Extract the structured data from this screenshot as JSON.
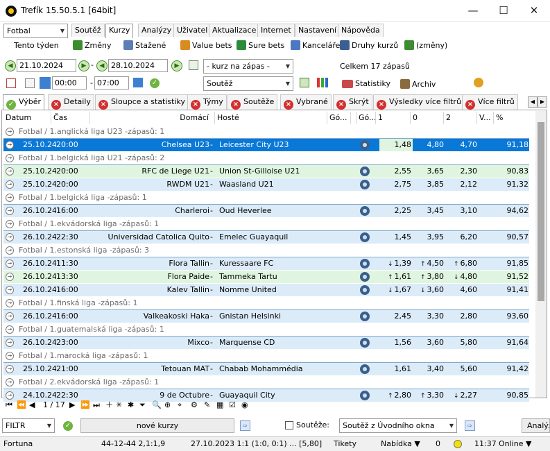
{
  "window": {
    "title": "Trefík 15.50.5.1 [64bit]",
    "min": "—",
    "max": "☐",
    "close": "✕"
  },
  "sport_select": "Fotbal",
  "top_tabs": [
    "Soutěž",
    "Kurzy",
    "Analýzy",
    "Uživatel",
    "Aktualizace",
    "Internet",
    "Nastavení",
    "Nápověda"
  ],
  "period_button": "Tento týden",
  "toolbar": {
    "zmeny": "Změny",
    "stazene": "Stažené",
    "value_bets": "Value bets",
    "sure_bets": "Sure bets",
    "kancelare": "Kanceláře",
    "druhy_kurzu": "Druhy kurzů",
    "zmeny2": "(změny)"
  },
  "filters": {
    "date_from": "21.10.2024",
    "date_to": "28.10.2024",
    "dash": "-",
    "time_from": "00:00",
    "time_to": "07:00",
    "odds_select": "- kurz na zápas -",
    "comp_select": "Soutěž",
    "total": "Celkem 17 zápasů",
    "statistiky": "Statistiky",
    "archiv": "Archiv"
  },
  "bottom_tabs": [
    "Výběr",
    "Detaily",
    "Sloupce a statistiky",
    "Týmy",
    "Soutěže",
    "Vybrané",
    "Skrýt",
    "Výsledky více filtrů",
    "Více filtrů"
  ],
  "columns": [
    "Datum",
    "Čas",
    "Domácí",
    "Hosté",
    "Gó...",
    "Gó...",
    "1",
    "0",
    "2",
    "V...",
    "%"
  ],
  "rows": [
    {
      "type": "group",
      "text": "Fotbal / 1.anglická liga U23 -zápasů: 1"
    },
    {
      "type": "sel",
      "date": "25.10.24",
      "time": "20:00",
      "home": "Chelsea U23",
      "away": "Leicester City U23",
      "o1": "1,48",
      "o0": "4,80",
      "o2": "4,70",
      "pct": "91,18"
    },
    {
      "type": "group",
      "text": "Fotbal / 1.belgická liga U21 -zápasů: 2"
    },
    {
      "type": "green",
      "date": "25.10.24",
      "time": "20:00",
      "home": "RFC de Liege U21",
      "away": "Union St-Gilloise U21",
      "o1": "2,55",
      "o0": "3,65",
      "o2": "2,30",
      "pct": "90,83"
    },
    {
      "type": "match",
      "date": "25.10.24",
      "time": "20:00",
      "home": "RWDM U21",
      "away": "Waasland U21",
      "o1": "2,75",
      "o0": "3,85",
      "o2": "2,12",
      "pct": "91,32"
    },
    {
      "type": "group",
      "text": "Fotbal / 1.belgická liga -zápasů: 1"
    },
    {
      "type": "match",
      "date": "26.10.24",
      "time": "16:00",
      "home": "Charleroi",
      "away": "Oud Heverlee",
      "o1": "2,25",
      "o0": "3,45",
      "o2": "3,10",
      "pct": "94,62"
    },
    {
      "type": "group",
      "text": "Fotbal / 1.ekvádorská liga -zápasů: 1"
    },
    {
      "type": "match",
      "date": "26.10.24",
      "time": "22:30",
      "home": "Universidad Catolica Quito",
      "away": "Emelec Guayaquil",
      "o1": "1,45",
      "o0": "3,95",
      "o2": "6,20",
      "pct": "90,57"
    },
    {
      "type": "group",
      "text": "Fotbal / 1.estonská liga -zápasů: 3"
    },
    {
      "type": "match",
      "date": "26.10.24",
      "time": "11:30",
      "home": "Flora Tallin",
      "away": "Kuressaare FC",
      "a1": "↓",
      "o1": "1,39",
      "a0": "↑",
      "o0": "4,50",
      "a2": "↑",
      "o2": "6,80",
      "pct": "91,85"
    },
    {
      "type": "green",
      "date": "26.10.24",
      "time": "13:30",
      "home": "Flora Paide",
      "away": "Tammeka Tartu",
      "a1": "↑",
      "o1": "1,61",
      "a0": "↑",
      "o0": "3,80",
      "a2": "↓",
      "o2": "4,80",
      "pct": "91,52"
    },
    {
      "type": "match",
      "date": "26.10.24",
      "time": "16:00",
      "home": "Kalev Tallin",
      "away": "Nomme United",
      "a1": "↓",
      "o1": "1,67",
      "a0": "↓",
      "o0": "3,60",
      "o2": "4,60",
      "pct": "91,41"
    },
    {
      "type": "group",
      "text": "Fotbal / 1.finská liga -zápasů: 1"
    },
    {
      "type": "match",
      "date": "26.10.24",
      "time": "16:00",
      "home": "Valkeakoski Haka",
      "away": "Gnistan Helsinki",
      "o1": "2,45",
      "o0": "3,30",
      "o2": "2,80",
      "pct": "93,60"
    },
    {
      "type": "group",
      "text": "Fotbal / 1.guatemalská liga -zápasů: 1"
    },
    {
      "type": "match",
      "date": "26.10.24",
      "time": "23:00",
      "home": "Mixco",
      "away": "Marquense CD",
      "o1": "1,56",
      "o0": "3,60",
      "o2": "5,80",
      "pct": "91,64"
    },
    {
      "type": "group",
      "text": "Fotbal / 1.marocká liga -zápasů: 1"
    },
    {
      "type": "match",
      "date": "25.10.24",
      "time": "21:00",
      "home": "Tetouan MAT",
      "away": "Chabab Mohammédia",
      "o1": "1,61",
      "o0": "3,40",
      "o2": "5,60",
      "pct": "91,42"
    },
    {
      "type": "group",
      "text": "Fotbal / 2.ekvádorská liga -zápasů: 1"
    },
    {
      "type": "match",
      "date": "24.10.24",
      "time": "22:30",
      "home": "9 de Octubre",
      "away": "Guayaquil City",
      "a1": "↑",
      "o1": "2,80",
      "a0": "↑",
      "o0": "3,30",
      "a2": "↓",
      "o2": "2,27",
      "pct": "90,85"
    }
  ],
  "pager": {
    "page": "1 / 17"
  },
  "filter_bar": {
    "filter_select": "FILTR",
    "new_odds": "nové kurzy",
    "comps_label": "Soutěže:",
    "comps_select": "Soutěž z Úvodního okna",
    "analyze": "Analýz"
  },
  "statusbar": {
    "bookmaker": "Fortuna",
    "score": "44-12-44  2,1:1,9",
    "last": "27.10.2023 1:1 (1:0, 0:1) ... [5,80]",
    "tickets": "Tikety",
    "offer": "Nabídka ▼",
    "count": "0",
    "time": "11:37",
    "online": "Online ▼"
  },
  "colors": {
    "selection": "#0a78d7",
    "match_row": "#dcebf8",
    "highlight_row": "#dff5df"
  }
}
